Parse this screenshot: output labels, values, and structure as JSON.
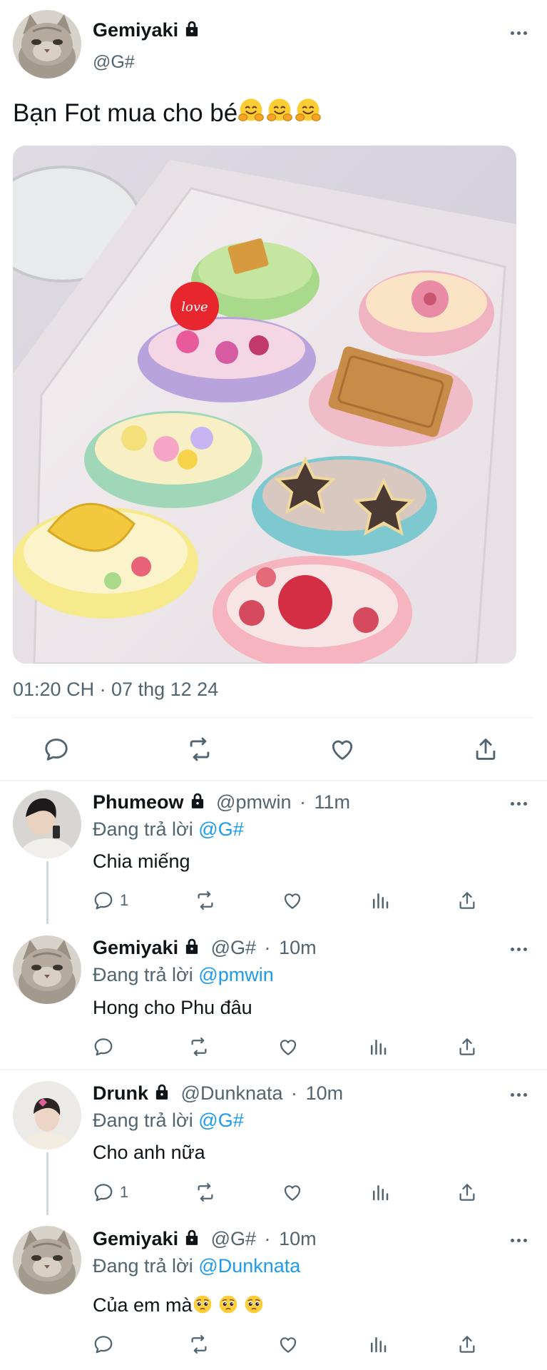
{
  "main_tweet": {
    "display_name": "Gemiyaki",
    "handle": "@G#",
    "text": "Bạn Fot mua cho bé",
    "emojis": [
      "hugging-face",
      "hugging-face",
      "hugging-face"
    ],
    "photo_alt": "Box of eight decorated sandwich cookies with pastel icing and toppings",
    "photo_decorations": [
      "love"
    ],
    "timestamp": "01:20 CH · 07 thg 12 24"
  },
  "replies": [
    {
      "display_name": "Phumeow",
      "handle": "@pmwin",
      "time": "11m",
      "reply_prefix": "Đang trả lời",
      "reply_to": "@G#",
      "text": "Chia miếng",
      "reply_count": "1"
    },
    {
      "display_name": "Gemiyaki",
      "handle": "@G#",
      "time": "10m",
      "reply_prefix": "Đang trả lời",
      "reply_to": "@pmwin",
      "text": "Hong cho Phu đâu",
      "reply_count": ""
    },
    {
      "display_name": "Drunk",
      "handle": "@Dunknata",
      "time": "10m",
      "reply_prefix": "Đang trả lời",
      "reply_to": "@G#",
      "text": "Cho anh nữa",
      "reply_count": "1"
    },
    {
      "display_name": "Gemiyaki",
      "handle": "@G#",
      "time": "10m",
      "reply_prefix": "Đang trả lời",
      "reply_to": "@Dunknata",
      "text": "Của em mà",
      "emojis": [
        "pleading-face",
        "pleading-face",
        "pleading-face"
      ],
      "reply_count": ""
    }
  ],
  "separator": "·",
  "colors": {
    "text": "#0f1419",
    "muted": "#536471",
    "link": "#1d9bf0",
    "divider": "#eff3f4",
    "thread_line": "#cfd9de"
  }
}
